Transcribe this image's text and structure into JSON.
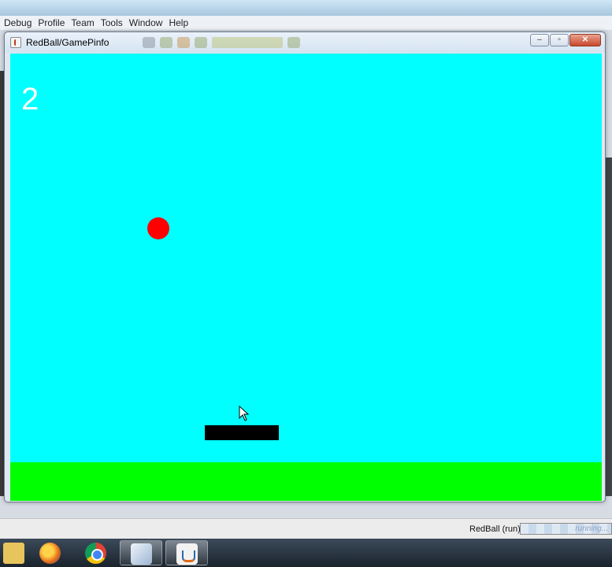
{
  "ide": {
    "menu": [
      "Debug",
      "Profile",
      "Team",
      "Tools",
      "Window",
      "Help"
    ]
  },
  "window": {
    "title": "RedBall/GamePinfo",
    "controls": {
      "minimize": "–",
      "maximize": "▫",
      "close": "✕"
    }
  },
  "game": {
    "score": "2",
    "colors": {
      "sky": "#00ffff",
      "ground": "#00ff00",
      "ball": "#ff0000",
      "paddle": "#000000",
      "score_text": "#ffffff"
    }
  },
  "statusbar": {
    "task_label": "RedBall (run)",
    "progress_text": "running..."
  },
  "taskbar": {
    "items": [
      "folder-icon",
      "firefox-icon",
      "chrome-icon",
      "virtualbox-icon",
      "java-icon"
    ]
  }
}
